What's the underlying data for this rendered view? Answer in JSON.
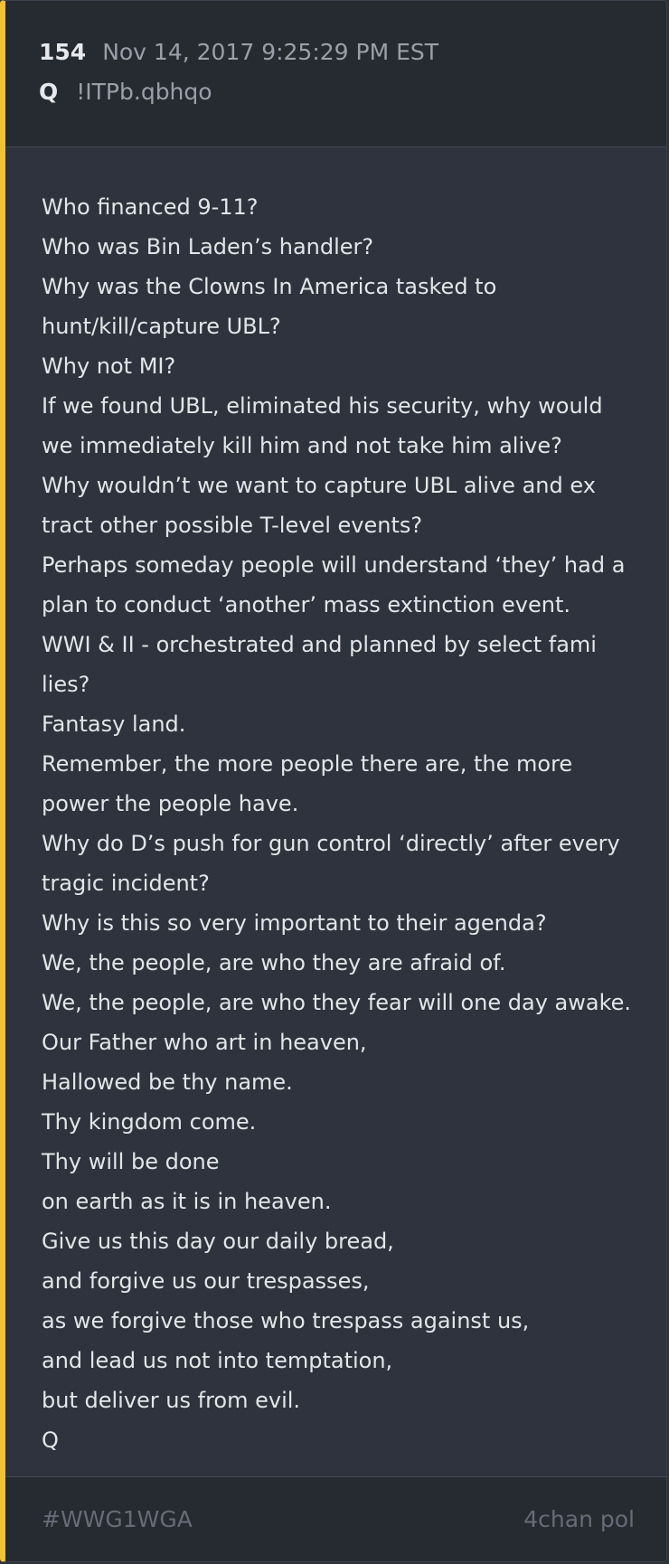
{
  "post": {
    "number": "154",
    "date": "Nov 14, 2017 9:25:29 PM EST",
    "author": "Q",
    "tripcode": "!ITPb.qbhqo",
    "lines": [
      "Who financed 9-11?",
      "Who was Bin Laden’s handler?",
      "Why was the Clowns In America tasked to",
      "hunt/kill/capture UBL?",
      "Why not MI?",
      "If we found UBL, eliminated his security, why would",
      "we immediately kill him and not take him alive?",
      "Why wouldn’t we want to capture UBL alive and ex",
      "tract other possible T-level events?",
      "Perhaps someday people will understand ‘they’ had a",
      "plan to conduct ‘another’ mass extinction event.",
      "WWI & II - orchestrated and planned by select fami",
      "lies?",
      "Fantasy land.",
      "Remember, the more people there are, the more",
      "power the people have.",
      "Why do D’s push for gun control ‘directly’ after every",
      "tragic incident?",
      "Why is this so very important to their agenda?",
      "We, the people, are who they are afraid of.",
      "We, the people, are who they fear will one day awake.",
      "Our Father who art in heaven,",
      "Hallowed be thy name.",
      "Thy kingdom come.",
      "Thy will be done",
      "on earth as it is in heaven.",
      "Give us this day our daily bread,",
      "and forgive us our trespasses,",
      "as we forgive those who trespass against us,",
      "and lead us not into temptation,",
      "but deliver us from evil.",
      "Q"
    ]
  },
  "footer": {
    "tag": "#WWG1WGA",
    "source": "4chan pol"
  },
  "colors": {
    "accent": "#f1c232",
    "background": "#2e333d",
    "header_background": "#262a31"
  }
}
